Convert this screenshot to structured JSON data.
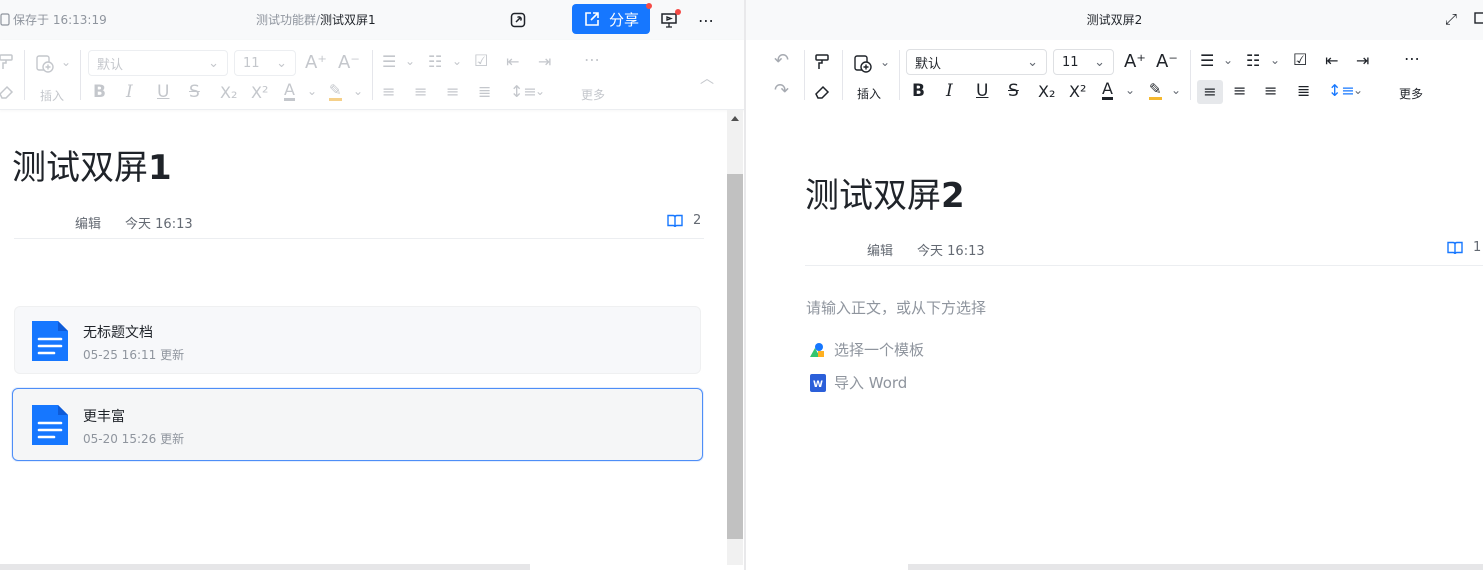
{
  "left_pane": {
    "topbar": {
      "save_status": "保存于 16:13:19",
      "path_parent": "测试功能群/",
      "path_current": "测试双屏1",
      "share_label": "分享",
      "more_icon": "more-icon"
    },
    "toolbar": {
      "font_name": "默认",
      "font_size": "11",
      "insert_label": "插入",
      "more_label": "更多"
    },
    "doc": {
      "title_text": "测试双屏",
      "title_num": "1",
      "meta_action": "编辑",
      "meta_time": "今天 16:13",
      "reader_count": "2"
    },
    "cards": [
      {
        "title": "无标题文档",
        "subtitle": "05-25 16:11 更新"
      },
      {
        "title": "更丰富",
        "subtitle": "05-20 15:26 更新"
      }
    ]
  },
  "right_pane": {
    "topbar": {
      "title": "测试双屏2"
    },
    "toolbar": {
      "font_name": "默认",
      "font_size": "11",
      "insert_label": "插入",
      "more_label": "更多"
    },
    "doc": {
      "title_text": "测试双屏",
      "title_num": "2",
      "meta_action": "编辑",
      "meta_time": "今天 16:13",
      "reader_count": "1",
      "placeholder": "请输入正文，或从下方选择",
      "options": [
        {
          "label": "选择一个模板",
          "icon": "template-icon"
        },
        {
          "label": "导入 Word",
          "icon": "word-icon"
        }
      ]
    }
  },
  "colors": {
    "accent": "#1677ff",
    "selected_border": "#4e8ef7",
    "badge": "#f54a45",
    "text_primary": "#1f2329",
    "text_secondary": "#8f959e"
  }
}
